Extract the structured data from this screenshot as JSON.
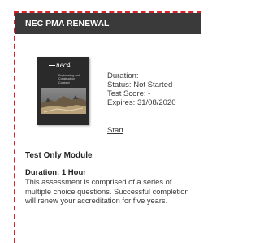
{
  "card": {
    "title": "NEC PMA RENEWAL",
    "book": {
      "logo": "nec4",
      "title": "Engineering and Construction Contract"
    },
    "meta": {
      "duration": "Duration:",
      "status": "Status: Not Started",
      "test_score": "Test Score: -",
      "expires": "Expires: 31/08/2020"
    },
    "start_label": "Start",
    "module_title": "Test Only Module",
    "duration_label": "Duration: 1 Hour",
    "description": "This assessment is comprised of a series of multiple choice questions. Successful completion will renew your accreditation for five years."
  },
  "colors": {
    "header_bg": "#3a3a3a",
    "dashed_border": "#d9232a",
    "text": "#333333"
  },
  "icons": [
    "book-cover-image"
  ]
}
